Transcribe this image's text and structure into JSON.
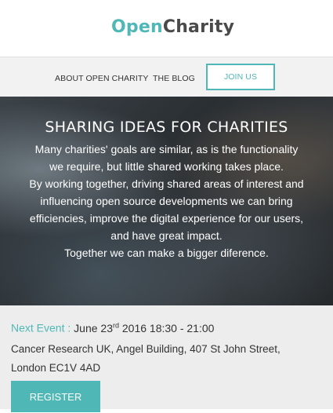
{
  "brand": {
    "logo_open": "Open",
    "logo_charity": "Charity"
  },
  "nav": {
    "about_label": "ABOUT OPEN CHARITY",
    "blog_label": "THE BLOG",
    "join_label": "JOIN US"
  },
  "hero": {
    "title": "SHARING IDEAS FOR CHARITIES",
    "lines": [
      "Many charities' goals are similar, as is the functionality",
      "we require, but little shared working takes place.",
      "By working together, driving shared areas of interest and",
      "influencing open source developments we can bring",
      "efficiencies, improve the digital experience for our users,",
      "and have great impact.",
      "Together we can make a bigger diference."
    ]
  },
  "event": {
    "label": "Next Event :",
    "date_prefix": "June 23",
    "date_suffix": "rd",
    "date_rest": "2016 18:30 - 21:00",
    "address_line1": "Cancer Research UK, Angel Building, 407 St John Street,",
    "address_line2": "London EC1V 4AD",
    "register_label": "REGISTER"
  },
  "colors": {
    "accent": "#4fb8b7",
    "text": "#333333",
    "nav_bg": "#f2f2f2",
    "event_bg": "#ededed"
  }
}
